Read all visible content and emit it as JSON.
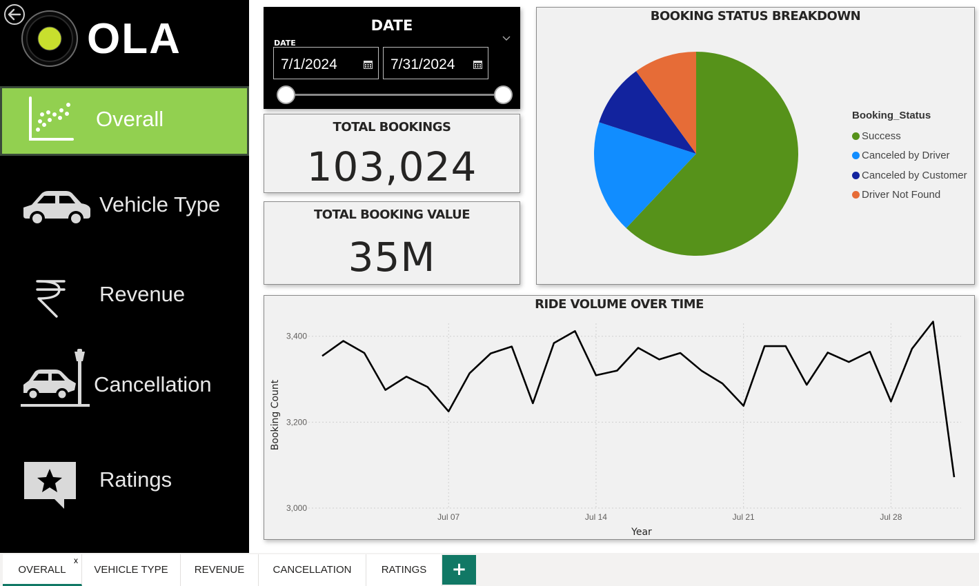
{
  "app": {
    "logo_text": "OLA",
    "brand_green": "#92d050",
    "accent_teal": "#117865"
  },
  "sidebar": {
    "items": [
      {
        "label": "Overall",
        "icon": "scatter-chart-icon",
        "active": true
      },
      {
        "label": "Vehicle Type",
        "icon": "car-icon",
        "active": false
      },
      {
        "label": "Revenue",
        "icon": "rupee-icon",
        "active": false
      },
      {
        "label": "Cancellation",
        "icon": "car-crash-icon",
        "active": false
      },
      {
        "label": "Ratings",
        "icon": "star-speech-bubble-icon",
        "active": false
      }
    ]
  },
  "date_slicer": {
    "title": "DATE",
    "field_label": "DATE",
    "start": "7/1/2024",
    "end": "7/31/2024",
    "range_fraction": [
      0,
      1
    ]
  },
  "kpis": {
    "total_bookings": {
      "title": "TOTAL BOOKINGS",
      "value": "103,024"
    },
    "total_booking_value": {
      "title": "TOTAL BOOKING VALUE",
      "value": "35M"
    }
  },
  "chart_data": [
    {
      "type": "pie",
      "title": "BOOKING STATUS BREAKDOWN",
      "legend_title": "Booking_Status",
      "legend_position": "right",
      "categories": [
        "Success",
        "Canceled by Driver",
        "Canceled by Customer",
        "Driver Not Found"
      ],
      "values": [
        62,
        18,
        10,
        10
      ],
      "colors": [
        "#56921a",
        "#118dff",
        "#12239e",
        "#e66c37"
      ]
    },
    {
      "type": "line",
      "title": "RIDE VOLUME OVER TIME",
      "xlabel": "Year",
      "ylabel": "Booking Count",
      "ylim": [
        3000,
        3430
      ],
      "yticks": [
        3000,
        3200,
        3400
      ],
      "ytick_labels": [
        "3,000",
        "3,200",
        "3,400"
      ],
      "xtick_labels": [
        "Jul 07",
        "Jul 14",
        "Jul 21",
        "Jul 28"
      ],
      "xtick_days": [
        7,
        14,
        21,
        28
      ],
      "grid": true,
      "x": [
        "2024-07-01",
        "2024-07-02",
        "2024-07-03",
        "2024-07-04",
        "2024-07-05",
        "2024-07-06",
        "2024-07-07",
        "2024-07-08",
        "2024-07-09",
        "2024-07-10",
        "2024-07-11",
        "2024-07-12",
        "2024-07-13",
        "2024-07-14",
        "2024-07-15",
        "2024-07-16",
        "2024-07-17",
        "2024-07-18",
        "2024-07-19",
        "2024-07-20",
        "2024-07-21",
        "2024-07-22",
        "2024-07-23",
        "2024-07-24",
        "2024-07-25",
        "2024-07-26",
        "2024-07-27",
        "2024-07-28",
        "2024-07-29",
        "2024-07-30",
        "2024-07-31"
      ],
      "series": [
        {
          "values": [
            3354,
            3389,
            3361,
            3275,
            3306,
            3282,
            3225,
            3314,
            3360,
            3376,
            3244,
            3384,
            3412,
            3309,
            3320,
            3373,
            3346,
            3361,
            3320,
            3290,
            3238,
            3377,
            3377,
            3287,
            3362,
            3340,
            3364,
            3248,
            3371,
            3434,
            3072
          ],
          "color": "#000000"
        }
      ]
    }
  ],
  "tabs": [
    {
      "label": "OVERALL",
      "active": true,
      "close": "x"
    },
    {
      "label": "VEHICLE TYPE",
      "active": false
    },
    {
      "label": "REVENUE",
      "active": false
    },
    {
      "label": "CANCELLATION",
      "active": false
    },
    {
      "label": "RATINGS",
      "active": false
    }
  ],
  "add_tab_label": "+"
}
